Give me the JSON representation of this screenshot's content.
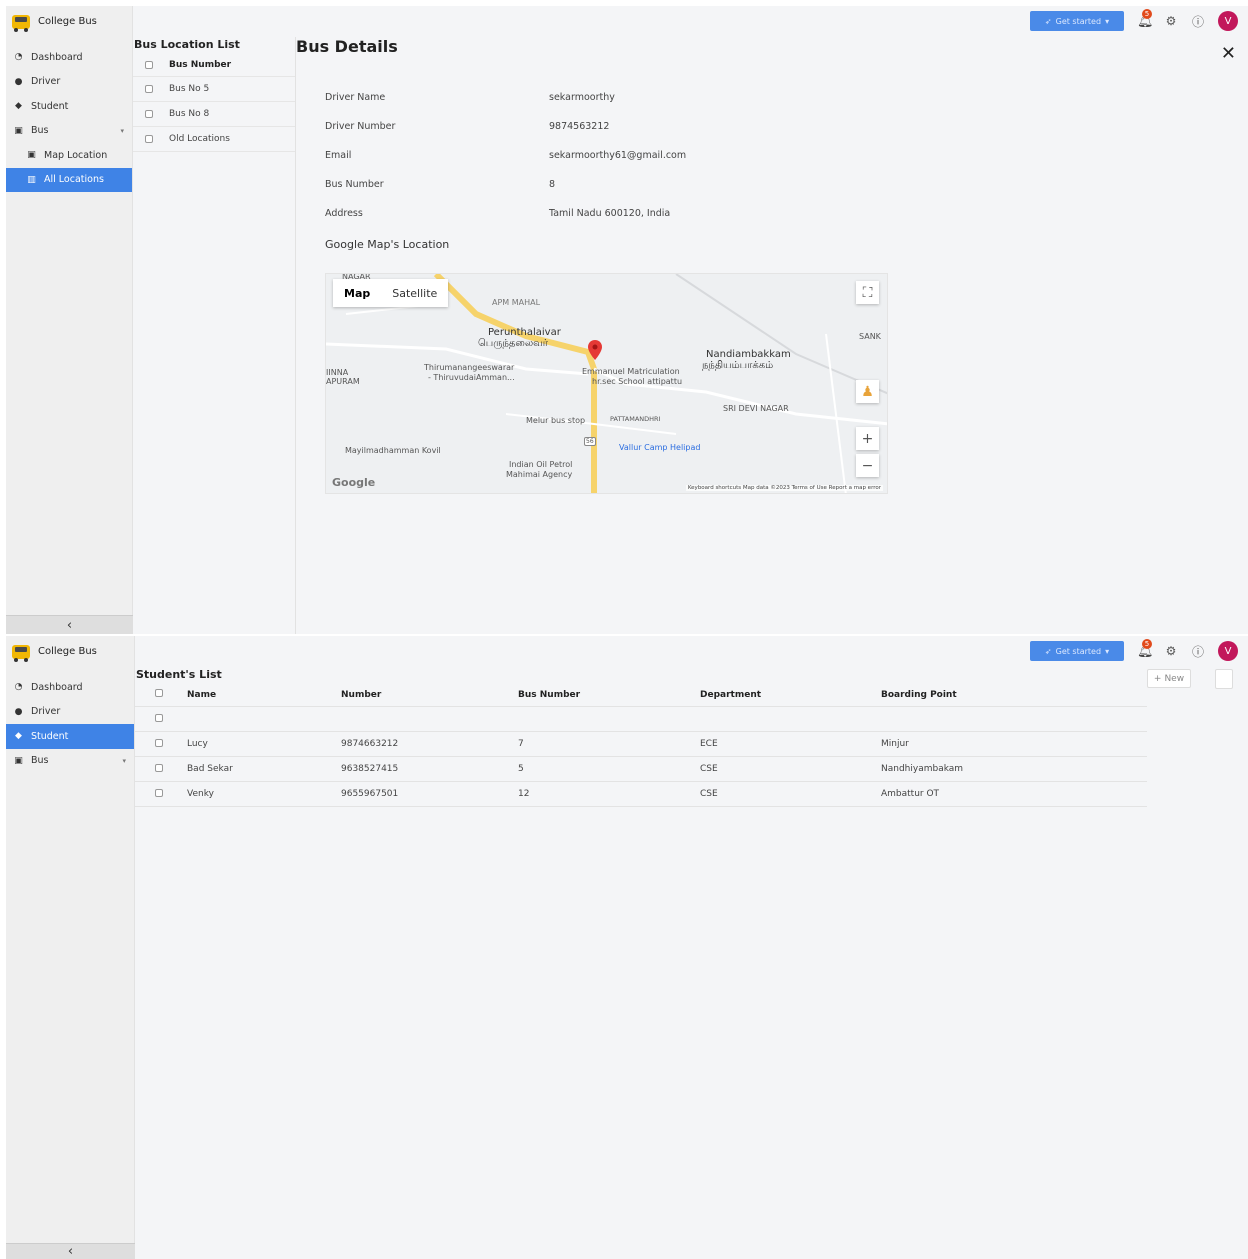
{
  "app": {
    "title": "College Bus"
  },
  "topbar": {
    "get_started": "Get started",
    "notification_count": "5",
    "avatar_initial": "V"
  },
  "screen1": {
    "nav": [
      {
        "label": "Dashboard",
        "icon": "dashboard-icon"
      },
      {
        "label": "Driver",
        "icon": "person-icon"
      },
      {
        "label": "Student",
        "icon": "graduation-cap-icon"
      },
      {
        "label": "Bus",
        "icon": "bus-icon"
      },
      {
        "label": "Map Location",
        "icon": "bus-icon"
      },
      {
        "label": "All Locations",
        "icon": "map-icon"
      }
    ],
    "location_list": {
      "title": "Bus Location List",
      "header": "Bus Number",
      "rows": [
        "Bus No 5",
        "Bus No 8",
        "Old Locations"
      ]
    },
    "details": {
      "title": "Bus Details",
      "fields": [
        {
          "label": "Driver Name",
          "value": "sekarmoorthy"
        },
        {
          "label": "Driver Number",
          "value": "9874563212"
        },
        {
          "label": "Email",
          "value": "sekarmoorthy61@gmail.com"
        },
        {
          "label": "Bus Number",
          "value": "8"
        },
        {
          "label": "Address",
          "value": "Tamil Nadu 600120, India"
        }
      ],
      "map_title": "Google Map's Location",
      "map": {
        "tab_map": "Map",
        "tab_satellite": "Satellite",
        "labels": {
          "nagar": "NAGAR",
          "apm": "APM MAHAL",
          "perunthalaivar": "Perunthalaivar",
          "perunthalaivar_ta": "பெருந்தலைவர்",
          "nandiambakkam": "Nandiambakkam",
          "nandiambakkam_ta": "நந்தியம்பாக்கம்",
          "sank": "SANK",
          "thirumanangeeswarar": "Thirumanangeeswarar",
          "thiruvudai": "- ThiruvudaiAmman...",
          "emmanuel": "Emmanuel Matriculation",
          "hrsec": "hr.sec School attipattu",
          "inna": "IINNA",
          "apuram": "APURAM",
          "sri_devi": "SRI DEVI NAGAR",
          "melur": "Melur bus stop",
          "pattamanthri": "PATTAMANDHRI",
          "vallur": "Vallur Camp Helipad",
          "mayil": "Mayilmadhamman Kovil",
          "indian_oil": "Indian Oil Petrol",
          "mahimai": "Mahimai Agency",
          "road": "56"
        },
        "google": "Google",
        "footer": "Keyboard shortcuts   Map data ©2023   Terms of Use   Report a map error"
      }
    }
  },
  "screen2": {
    "nav": [
      {
        "label": "Dashboard",
        "icon": "dashboard-icon"
      },
      {
        "label": "Driver",
        "icon": "person-icon"
      },
      {
        "label": "Student",
        "icon": "graduation-cap-icon"
      },
      {
        "label": "Bus",
        "icon": "bus-icon"
      }
    ],
    "students": {
      "title": "Student's List",
      "new_label": "New",
      "columns": [
        "Name",
        "Number",
        "Bus Number",
        "Department",
        "Boarding Point"
      ],
      "rows": [
        [
          "",
          "",
          "",
          "",
          ""
        ],
        [
          "Lucy",
          "9874663212",
          "7",
          "ECE",
          "Minjur"
        ],
        [
          "Bad Sekar",
          "9638527415",
          "5",
          "CSE",
          "Nandhiyambakam"
        ],
        [
          "Venky",
          "9655967501",
          "12",
          "CSE",
          "Ambattur OT"
        ]
      ]
    }
  },
  "colors": {
    "accent": "#3f83e6",
    "badge": "#e14a1c",
    "avatar": "#c2185b",
    "bus_yellow": "#f2b705"
  }
}
